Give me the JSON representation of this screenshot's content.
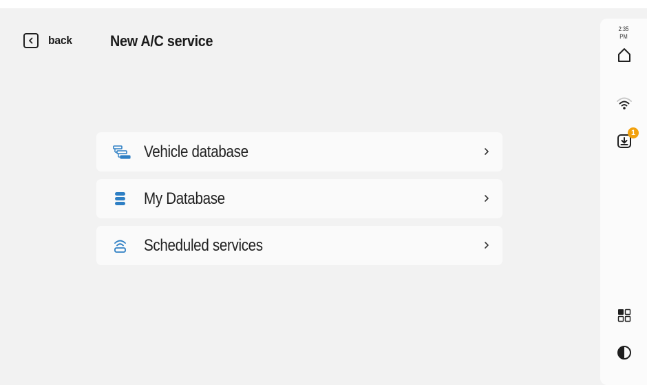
{
  "header": {
    "back_label": "back",
    "title": "New A/C service"
  },
  "menu": {
    "items": [
      {
        "label": "Vehicle database",
        "icon": "vehicle-database-icon"
      },
      {
        "label": "My Database",
        "icon": "database-icon"
      },
      {
        "label": "Scheduled services",
        "icon": "scheduled-services-icon"
      }
    ]
  },
  "sidebar": {
    "time": "2:35",
    "ampm": "PM",
    "download_badge_count": "1",
    "icons": [
      "home-icon",
      "wifi-icon",
      "download-icon",
      "apps-icon",
      "contrast-icon"
    ]
  },
  "colors": {
    "accent": "#2e7fc4",
    "badge": "#f2a10d",
    "background": "#f2f2f2",
    "card": "#fafafa"
  }
}
